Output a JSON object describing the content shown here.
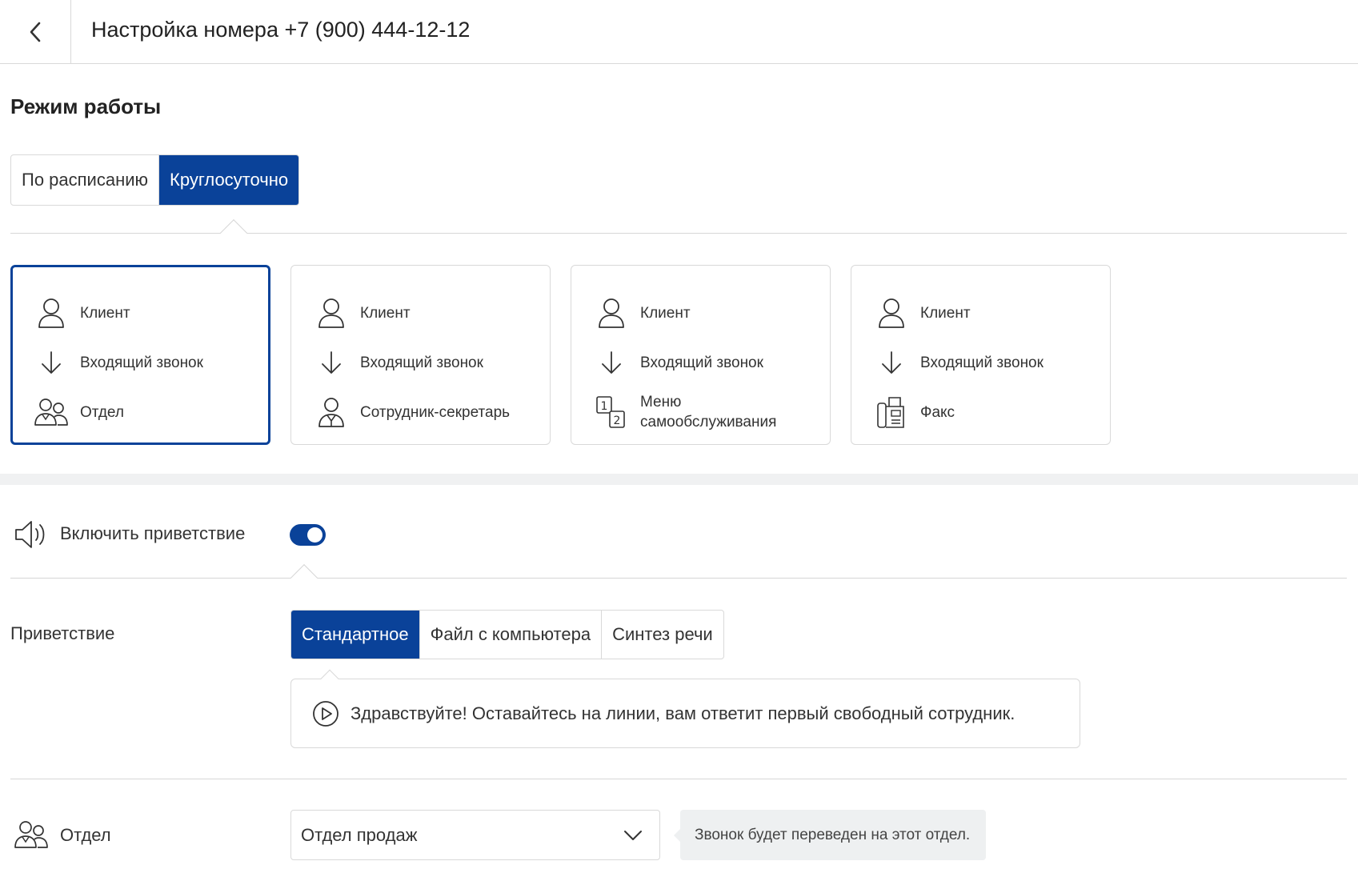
{
  "header": {
    "title": "Настройка номера +7 (900) 444-12-12",
    "back_icon": "chevron-left-icon"
  },
  "mode": {
    "title": "Режим работы",
    "tabs": [
      {
        "label": "По расписанию",
        "active": false
      },
      {
        "label": "Круглосуточно",
        "active": true
      }
    ]
  },
  "scenarios": [
    {
      "selected": true,
      "rows": [
        {
          "icon": "user-icon",
          "label": "Клиент"
        },
        {
          "icon": "arrow-down-icon",
          "label": "Входящий звонок"
        },
        {
          "icon": "group-icon",
          "label": "Отдел"
        }
      ]
    },
    {
      "selected": false,
      "rows": [
        {
          "icon": "user-icon",
          "label": "Клиент"
        },
        {
          "icon": "arrow-down-icon",
          "label": "Входящий звонок"
        },
        {
          "icon": "secretary-icon",
          "label": "Сотрудник-секретарь"
        }
      ]
    },
    {
      "selected": false,
      "rows": [
        {
          "icon": "user-icon",
          "label": "Клиент"
        },
        {
          "icon": "arrow-down-icon",
          "label": "Входящий звонок"
        },
        {
          "icon": "menu-12-icon",
          "label": "Меню самообслуживания"
        }
      ]
    },
    {
      "selected": false,
      "rows": [
        {
          "icon": "user-icon",
          "label": "Клиент"
        },
        {
          "icon": "arrow-down-icon",
          "label": "Входящий звонок"
        },
        {
          "icon": "fax-icon",
          "label": "Факс"
        }
      ]
    }
  ],
  "greeting_toggle": {
    "icon": "speaker-icon",
    "label": "Включить приветствие",
    "enabled": true
  },
  "greeting": {
    "label": "Приветствие",
    "tabs": [
      {
        "label": "Стандартное",
        "active": true
      },
      {
        "label": "Файл с компьютера",
        "active": false
      },
      {
        "label": "Синтез речи",
        "active": false
      }
    ],
    "text": "Здравствуйте! Оставайтесь на линии, вам ответит первый свободный сотрудник.",
    "play_icon": "play-icon"
  },
  "department": {
    "icon": "group-icon",
    "label": "Отдел",
    "selected": "Отдел продаж",
    "hint": "Звонок будет переведен на этот отдел."
  },
  "colors": {
    "accent": "#0a4299",
    "border": "#d9d9d9",
    "band": "#f0f1f2"
  }
}
